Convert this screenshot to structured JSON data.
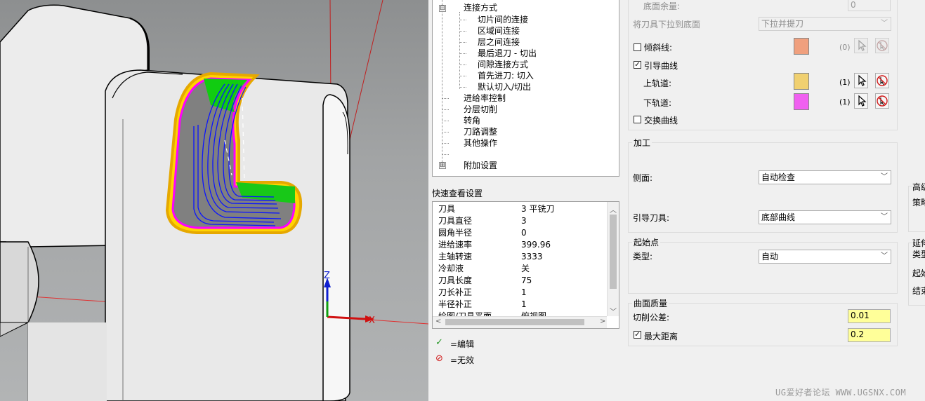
{
  "viewport": {
    "triad": {
      "x_label": "X",
      "z_label": "Z"
    }
  },
  "tree": {
    "items": [
      {
        "label": "连接方式",
        "expander": "⊟"
      },
      {
        "label": "切片间的连接"
      },
      {
        "label": "区域间连接"
      },
      {
        "label": "层之间连接"
      },
      {
        "label": "最后退刀 - 切出"
      },
      {
        "label": "间隙连接方式"
      },
      {
        "label": "首先进刀: 切入"
      },
      {
        "label": "默认切入/切出"
      },
      {
        "label": "进给率控制"
      },
      {
        "label": "分层切削"
      },
      {
        "label": "转角"
      },
      {
        "label": "刀路调整"
      },
      {
        "label": "其他操作"
      },
      {
        "label": ""
      },
      {
        "label": "附加设置",
        "expander": "⊞"
      }
    ]
  },
  "quick_view": {
    "title": "快速查看设置",
    "rows": [
      {
        "name": "刀具",
        "value": "3 平铣刀"
      },
      {
        "name": "刀具直径",
        "value": "3"
      },
      {
        "name": "圆角半径",
        "value": "0"
      },
      {
        "name": "进给速率",
        "value": "399.96"
      },
      {
        "name": "主轴转速",
        "value": "3333"
      },
      {
        "name": "冷却液",
        "value": "关"
      },
      {
        "name": "刀具长度",
        "value": "75"
      },
      {
        "name": "刀长补正",
        "value": "1"
      },
      {
        "name": "半径补正",
        "value": "1"
      },
      {
        "name": "绘图/刀具平面",
        "value": "俯视图"
      }
    ]
  },
  "legend": {
    "edit_icon": "check-icon",
    "edit_label": "=编辑",
    "invalid_icon": "prohibit-icon",
    "invalid_label": "=无效"
  },
  "form": {
    "bottom_stock_label": "底面余量:",
    "bottom_stock_value": "0",
    "pull_label": "将刀具下拉到底面",
    "pull_value": "下拉并提刀",
    "tilt_label": "倾斜线:",
    "tilt_checked": false,
    "tilt_color": "#f0a07e",
    "tilt_count": "(0)",
    "guide_label": "引导曲线",
    "guide_checked": true,
    "upper_label": "上轨道:",
    "upper_color": "#f0d070",
    "upper_count": "(1)",
    "lower_label": "下轨道:",
    "lower_color": "#f060f0",
    "lower_count": "(1)",
    "swap_label": "交换曲线",
    "swap_checked": false,
    "machining_title": "加工",
    "side_label": "侧面:",
    "side_value": "自动检查",
    "guide_tool_label": "引导刀具:",
    "guide_tool_value": "底部曲线",
    "start_title": "起始点",
    "type_label": "类型:",
    "type_value": "自动",
    "quality_title": "曲面质量",
    "tolerance_label": "切削公差:",
    "tolerance_value": "0.01",
    "maxdist_label": "最大距离",
    "maxdist_checked": true,
    "maxdist_value": "0.2"
  },
  "right_clipped": {
    "g1_title": "高级",
    "g1_item": "策略",
    "g2_title": "延伸",
    "g2_item1": "类型",
    "g2_item2": "起始",
    "g2_item3": "结束"
  },
  "watermark": "UG爱好者论坛 WWW.UGSNX.COM"
}
